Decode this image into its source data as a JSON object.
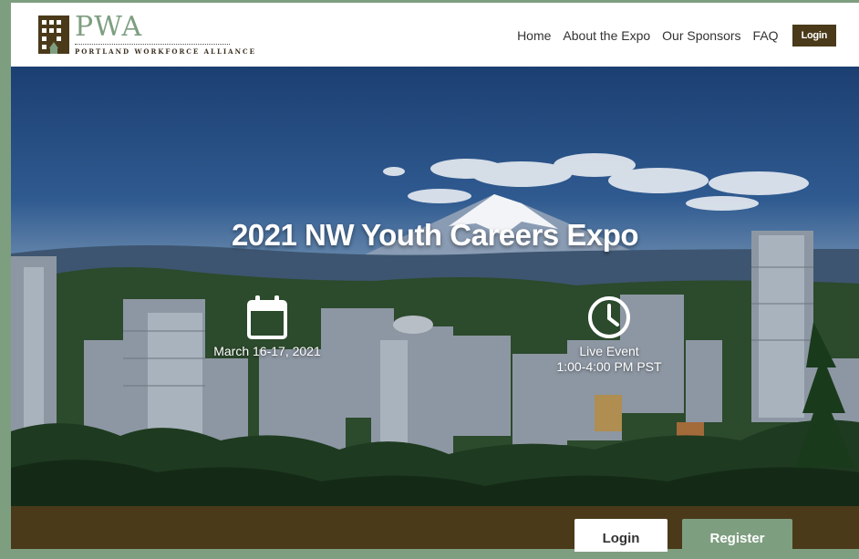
{
  "logo": {
    "title": "PWA",
    "subtitle": "PORTLAND WORKFORCE ALLIANCE"
  },
  "nav": {
    "items": [
      "Home",
      "About the Expo",
      "Our Sponsors",
      "FAQ"
    ],
    "login_label": "Login"
  },
  "hero": {
    "title": "2021 NW Youth Careers Expo",
    "date": "March 16-17, 2021",
    "event_type": "Live Event",
    "time": "1:00-4:00 PM PST"
  },
  "footer": {
    "login_label": "Login",
    "register_label": "Register"
  },
  "colors": {
    "brand_green": "#7e9e80",
    "brand_brown": "#4a3a1a"
  },
  "icons": [
    "building-logo-icon",
    "calendar-icon",
    "clock-icon"
  ]
}
